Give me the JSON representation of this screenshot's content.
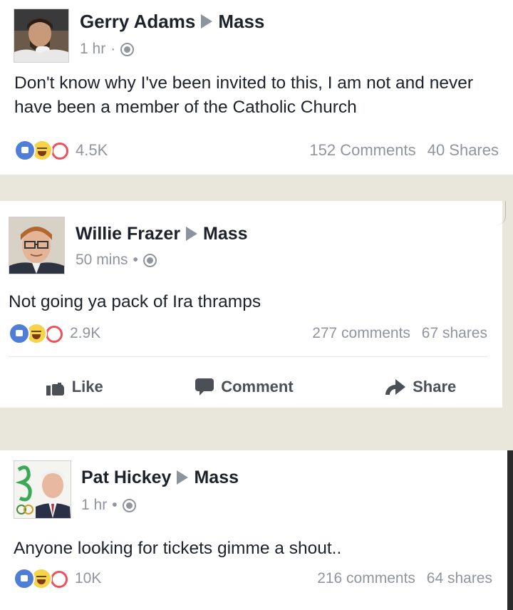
{
  "posts": [
    {
      "author": "Gerry Adams",
      "group": "Mass",
      "time": "1 hr",
      "separator": "·",
      "message": "Don't know why I've been invited to this, I am not and never have been a member of the Catholic Church",
      "reaction_count": "4.5K",
      "comments": "152 Comments",
      "shares": "40 Shares"
    },
    {
      "author": "Willie Frazer",
      "group": "Mass",
      "time": "50 mins",
      "separator": "•",
      "message": "Not going ya pack of Ira thramps",
      "reaction_count": "2.9K",
      "comments": "277 comments",
      "shares": "67 shares",
      "actions": {
        "like": "Like",
        "comment": "Comment",
        "share": "Share"
      }
    },
    {
      "author": "Pat Hickey",
      "group": "Mass",
      "time": "1 hr",
      "separator": "•",
      "message": "Anyone looking for tickets gimme a shout..",
      "reaction_count": "10K",
      "comments": "216 comments",
      "shares": "64 shares"
    }
  ],
  "icons": {
    "group_arrow": "arrow-icon",
    "privacy": "globe-icon",
    "reactions": [
      "like-react-icon",
      "haha-react-icon",
      "love-react-icon"
    ]
  },
  "colors": {
    "background": "#e9e6dc",
    "text": "#1d2129",
    "muted": "#90949c",
    "like_blue": "#4f7ed6",
    "love_red": "#f0505a",
    "haha_yellow": "#f7d34a"
  }
}
